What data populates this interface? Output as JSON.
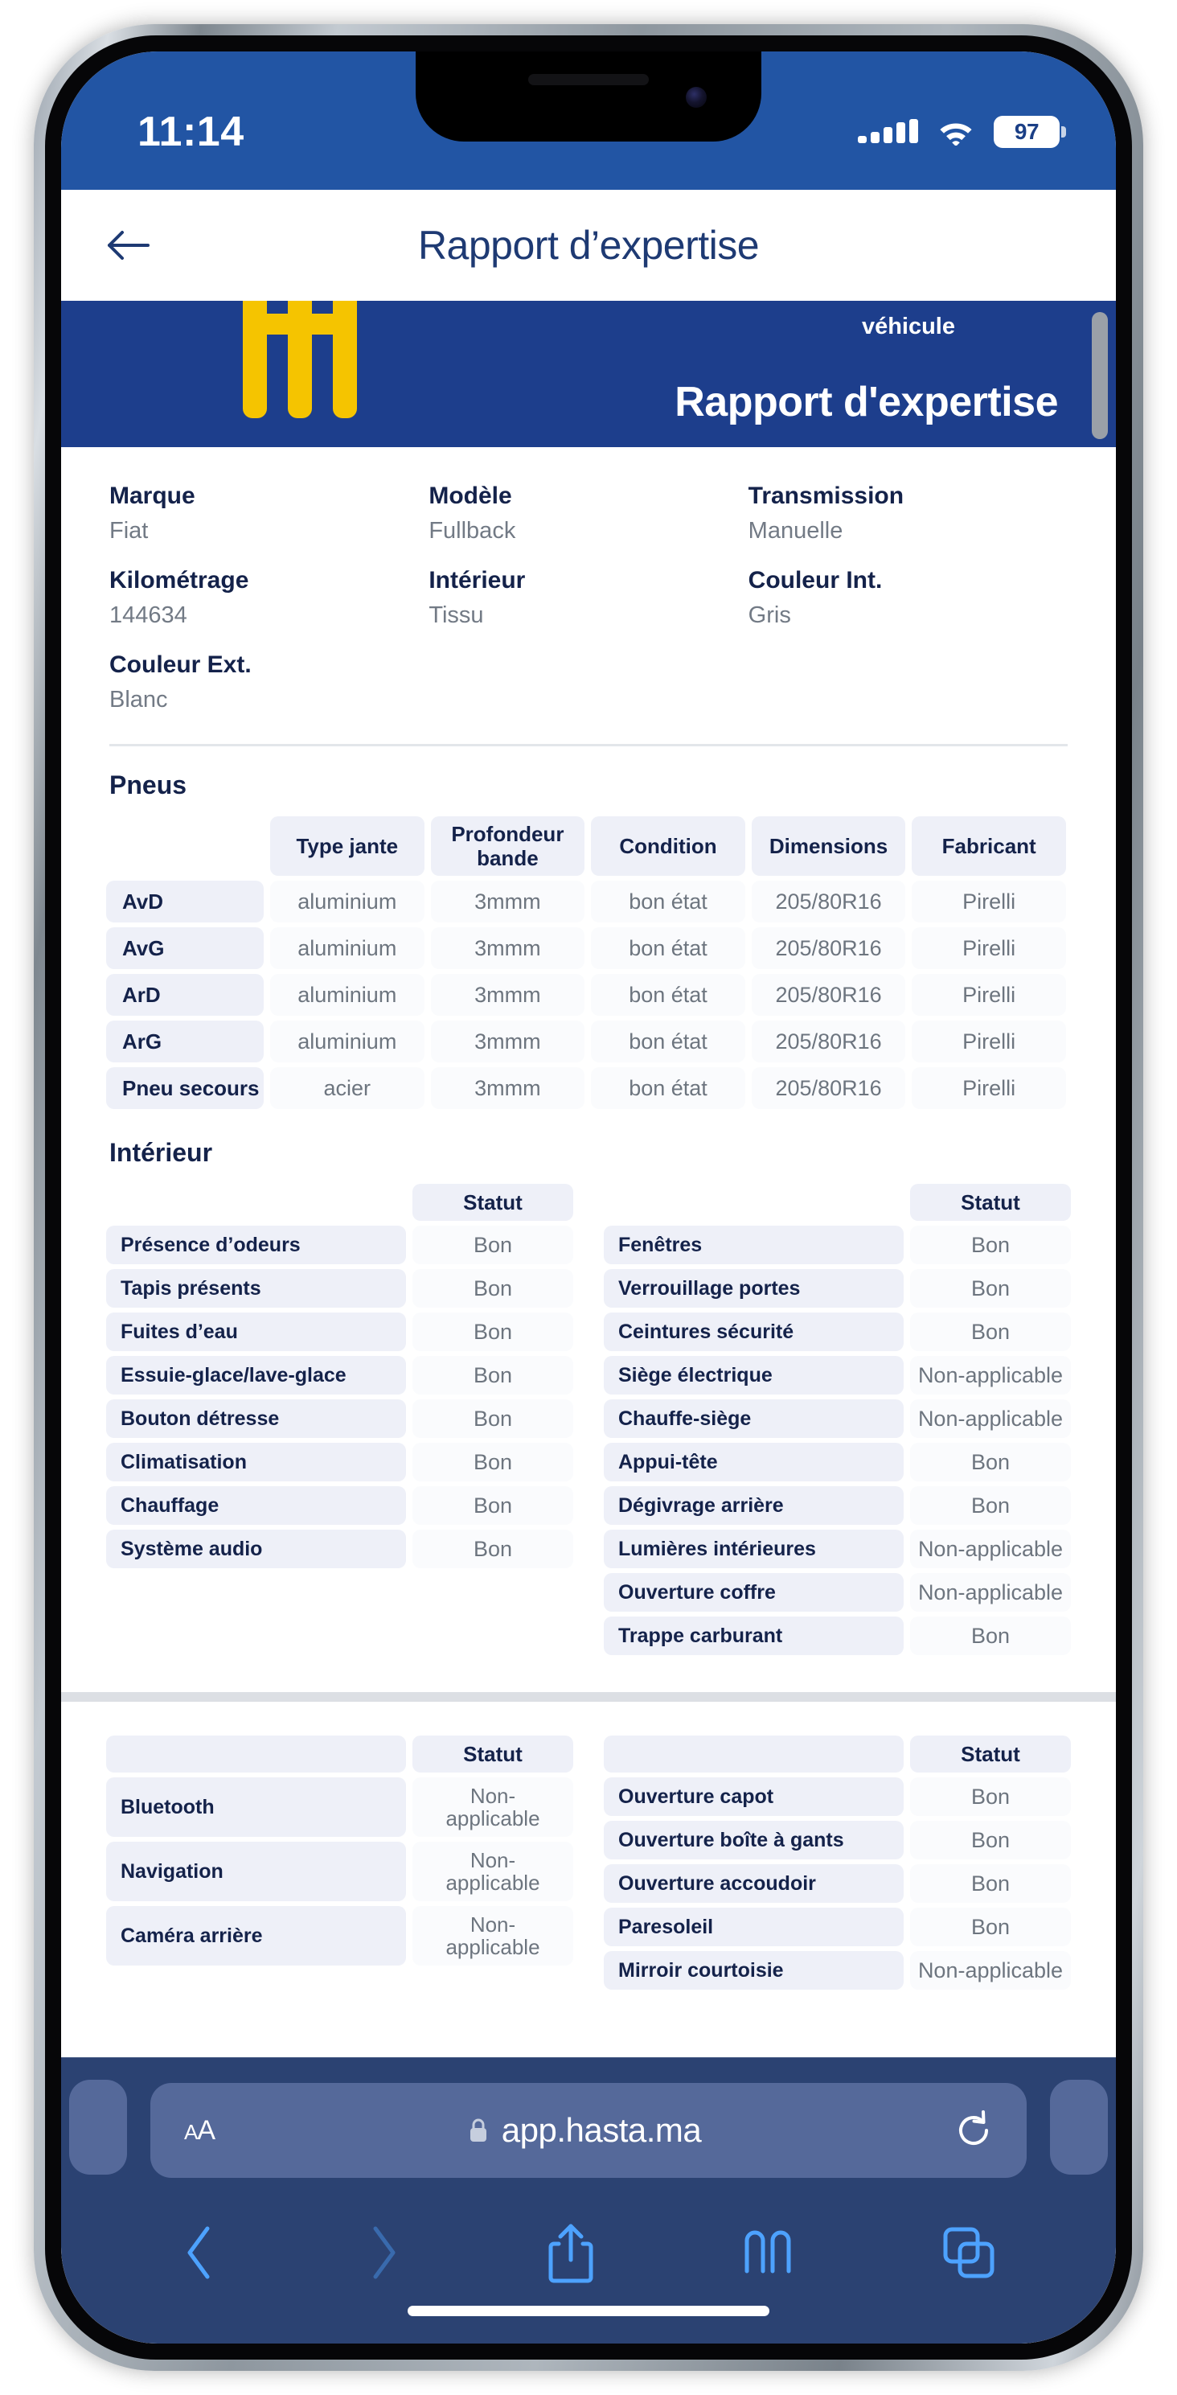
{
  "status_bar": {
    "time": "11:14",
    "battery_percent": "97",
    "signal_icon": "cellular-signal-icon",
    "wifi_icon": "wifi-icon",
    "battery_icon": "battery-icon"
  },
  "nav_header": {
    "back_icon": "back-arrow-icon",
    "title": "Rapport d’expertise"
  },
  "report_banner": {
    "subtitle": "véhicule",
    "title": "Rapport d'expertise",
    "logo_icon": "hasta-logo-icon"
  },
  "vehicle_info": [
    {
      "label": "Marque",
      "value": "Fiat"
    },
    {
      "label": "Modèle",
      "value": "Fullback"
    },
    {
      "label": "Transmission",
      "value": "Manuelle"
    },
    {
      "label": "Kilométrage",
      "value": "144634"
    },
    {
      "label": "Intérieur",
      "value": "Tissu"
    },
    {
      "label": "Couleur Int.",
      "value": "Gris"
    },
    {
      "label": "Couleur Ext.",
      "value": "Blanc"
    }
  ],
  "tires": {
    "section_title": "Pneus",
    "headers": [
      "",
      "Type jante",
      "Profondeur bande",
      "Condition",
      "Dimensions",
      "Fabricant"
    ],
    "rows": [
      {
        "position": "AvD",
        "type_jante": "aluminium",
        "profondeur": "3mmm",
        "condition": "bon état",
        "dimensions": "205/80R16",
        "fabricant": "Pirelli"
      },
      {
        "position": "AvG",
        "type_jante": "aluminium",
        "profondeur": "3mmm",
        "condition": "bon état",
        "dimensions": "205/80R16",
        "fabricant": "Pirelli"
      },
      {
        "position": "ArD",
        "type_jante": "aluminium",
        "profondeur": "3mmm",
        "condition": "bon état",
        "dimensions": "205/80R16",
        "fabricant": "Pirelli"
      },
      {
        "position": "ArG",
        "type_jante": "aluminium",
        "profondeur": "3mmm",
        "condition": "bon état",
        "dimensions": "205/80R16",
        "fabricant": "Pirelli"
      },
      {
        "position": "Pneu secours",
        "type_jante": "acier",
        "profondeur": "3mmm",
        "condition": "bon état",
        "dimensions": "205/80R16",
        "fabricant": "Pirelli"
      }
    ]
  },
  "interior": {
    "section_title": "Intérieur",
    "status_header": "Statut",
    "left_rows": [
      {
        "item": "Présence d’odeurs",
        "status": "Bon"
      },
      {
        "item": "Tapis présents",
        "status": "Bon"
      },
      {
        "item": "Fuites d’eau",
        "status": "Bon"
      },
      {
        "item": "Essuie-glace/lave-glace",
        "status": "Bon"
      },
      {
        "item": "Bouton détresse",
        "status": "Bon"
      },
      {
        "item": "Climatisation",
        "status": "Bon"
      },
      {
        "item": "Chauffage",
        "status": "Bon"
      },
      {
        "item": "Système audio",
        "status": "Bon"
      }
    ],
    "right_rows": [
      {
        "item": "Fenêtres",
        "status": "Bon"
      },
      {
        "item": "Verrouillage portes",
        "status": "Bon"
      },
      {
        "item": "Ceintures sécurité",
        "status": "Bon"
      },
      {
        "item": "Siège électrique",
        "status": "Non-applicable"
      },
      {
        "item": "Chauffe-siège",
        "status": "Non-applicable"
      },
      {
        "item": "Appui-tête",
        "status": "Bon"
      },
      {
        "item": "Dégivrage arrière",
        "status": "Bon"
      },
      {
        "item": "Lumières intérieures",
        "status": "Non-applicable"
      },
      {
        "item": "Ouverture coffre",
        "status": "Non-applicable"
      },
      {
        "item": "Trappe carburant",
        "status": "Bon"
      }
    ]
  },
  "equipment": {
    "status_header": "Statut",
    "left_rows": [
      {
        "item": "Bluetooth",
        "status": "Non-\napplicable"
      },
      {
        "item": "Navigation",
        "status": "Non-\napplicable"
      },
      {
        "item": "Caméra arrière",
        "status": "Non-\napplicable"
      }
    ],
    "right_rows": [
      {
        "item": "Ouverture capot",
        "status": "Bon"
      },
      {
        "item": "Ouverture boîte à gants",
        "status": "Bon"
      },
      {
        "item": "Ouverture accoudoir",
        "status": "Bon"
      },
      {
        "item": "Paresoleil",
        "status": "Bon"
      },
      {
        "item": "Mirroir courtoisie",
        "status": "Non-applicable"
      }
    ]
  },
  "safari": {
    "text_size_label": "A",
    "text_size_label_small": "A",
    "lock_icon": "lock-icon",
    "url": "app.hasta.ma",
    "reload_icon": "reload-icon",
    "back_icon": "chevron-left-icon",
    "forward_icon": "chevron-right-icon",
    "share_icon": "share-icon",
    "bookmarks_icon": "book-icon",
    "tabs_icon": "tabs-icon"
  },
  "colors": {
    "status_bar_blue": "#2255a4",
    "banner_blue": "#1d3e8c",
    "nav_title_blue": "#1e3a73",
    "logo_yellow": "#f5c400",
    "safari_chrome": "#2b4272",
    "safari_accent": "#4da2ff"
  }
}
